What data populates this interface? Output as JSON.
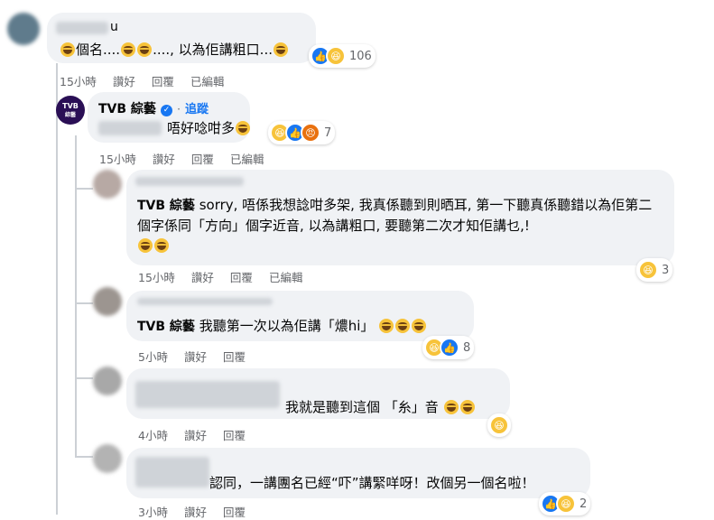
{
  "comments": [
    {
      "name": "u",
      "text": "個名....",
      "text2": "...., 以為佢講粗口...",
      "count": "106",
      "time": "15小時",
      "like": "讚好",
      "reply": "回覆",
      "edited": "已編輯"
    },
    {
      "name": "TVB 綜藝",
      "follow": "追蹤",
      "text": "唔好唸咁多",
      "count": "7",
      "time": "15小時",
      "like": "讚好",
      "reply": "回覆",
      "edited": "已編輯"
    },
    {
      "name": "TVB 綜藝",
      "text": " sorry, 唔係我想諗咁多架, 我真係聽到則晒耳, 第一下聽真係聽錯以為佢第二個字係同「方向」個字近音, 以為講粗口, 要聽第二次才知佢講乜,!",
      "count": "3",
      "time": "15小時",
      "like": "讚好",
      "reply": "回覆",
      "edited": "已編輯"
    },
    {
      "name": "TVB 綜藝",
      "text": " 我聽第一次以為佢講「燶hi」",
      "count": "8",
      "time": "5小時",
      "like": "讚好",
      "reply": "回覆"
    },
    {
      "text": "我就是聽到這個 「糸」音",
      "time": "4小時",
      "like": "讚好",
      "reply": "回覆"
    },
    {
      "text": "認同，一講團名已經“吓”講緊咩呀！改個另一個名啦！",
      "count": "2",
      "time": "3小時",
      "like": "讚好",
      "reply": "回覆"
    }
  ],
  "logo_text": "TVB",
  "colors": {
    "link": "#1877f2",
    "bubble": "#f0f2f5",
    "meta": "#65676b"
  }
}
